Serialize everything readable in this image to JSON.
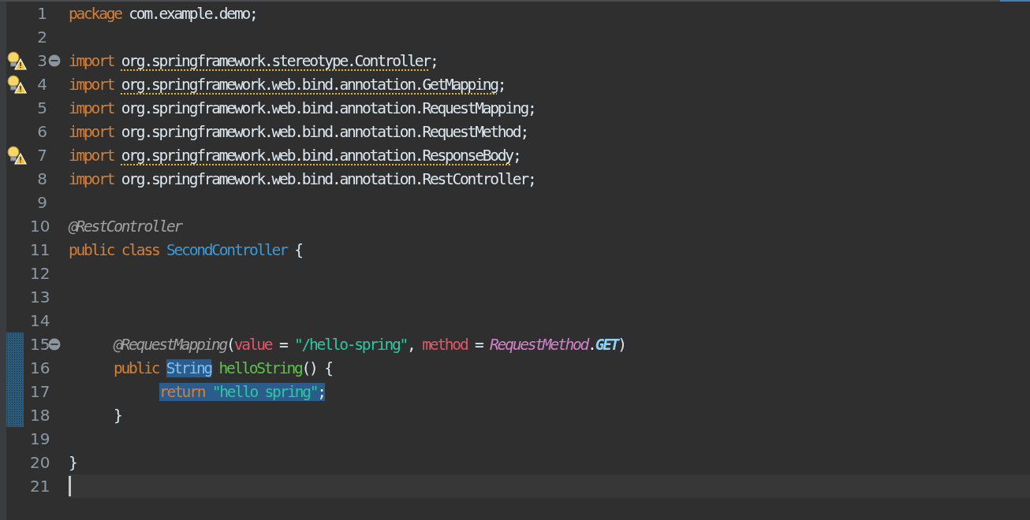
{
  "editor": {
    "lines": [
      {
        "number": "1",
        "kind": "top",
        "warning": false,
        "fold": false,
        "changed": false,
        "current": false,
        "tokens": [
          {
            "text": "package ",
            "kind": "keyword",
            "selected": false
          },
          {
            "text": "com.example.demo;",
            "kind": "plain",
            "selected": false
          }
        ]
      },
      {
        "number": "2",
        "kind": "top",
        "warning": false,
        "fold": false,
        "changed": false,
        "current": false
      },
      {
        "number": "3",
        "kind": "top",
        "warning": true,
        "fold": true,
        "changed": false,
        "current": false,
        "tokens": [
          {
            "text": "import ",
            "kind": "keyword",
            "selected": false
          },
          {
            "text": "org.springframework.stereotype.Controller",
            "kind": "warned",
            "selected": false
          },
          {
            "text": ";",
            "kind": "plain",
            "selected": false
          }
        ]
      },
      {
        "number": "4",
        "kind": "top",
        "warning": true,
        "fold": false,
        "changed": false,
        "current": false,
        "tokens": [
          {
            "text": "import ",
            "kind": "keyword",
            "selected": false
          },
          {
            "text": "org.springframework.web.bind.annotation.GetMapping",
            "kind": "warned",
            "selected": false
          },
          {
            "text": ";",
            "kind": "plain",
            "selected": false
          }
        ]
      },
      {
        "number": "5",
        "kind": "top",
        "warning": false,
        "fold": false,
        "changed": false,
        "current": false,
        "tokens": [
          {
            "text": "import ",
            "kind": "keyword",
            "selected": false
          },
          {
            "text": "org.springframework.web.bind.annotation.RequestMapping;",
            "kind": "plain",
            "selected": false
          }
        ]
      },
      {
        "number": "6",
        "kind": "top",
        "warning": false,
        "fold": false,
        "changed": false,
        "current": false,
        "tokens": [
          {
            "text": "import ",
            "kind": "keyword",
            "selected": false
          },
          {
            "text": "org.springframework.web.bind.annotation.RequestMethod;",
            "kind": "plain",
            "selected": false
          }
        ]
      },
      {
        "number": "7",
        "kind": "top",
        "warning": true,
        "fold": false,
        "changed": false,
        "current": false,
        "tokens": [
          {
            "text": "import ",
            "kind": "keyword",
            "selected": false
          },
          {
            "text": "org.springframework.web.bind.annotation.ResponseBody",
            "kind": "warned",
            "selected": false
          },
          {
            "text": ";",
            "kind": "plain",
            "selected": false
          }
        ]
      },
      {
        "number": "8",
        "kind": "top",
        "warning": false,
        "fold": false,
        "changed": false,
        "current": false,
        "tokens": [
          {
            "text": "import ",
            "kind": "keyword",
            "selected": false
          },
          {
            "text": "org.springframework.web.bind.annotation.RestController;",
            "kind": "plain",
            "selected": false
          }
        ]
      },
      {
        "number": "9",
        "kind": "top",
        "warning": false,
        "fold": false,
        "changed": false,
        "current": false
      },
      {
        "number": "10",
        "kind": "top",
        "warning": false,
        "fold": false,
        "changed": false,
        "current": false,
        "tokens": [
          {
            "text": "@RestController",
            "kind": "annotation",
            "selected": false
          }
        ]
      },
      {
        "number": "11",
        "kind": "top",
        "warning": false,
        "fold": false,
        "changed": false,
        "current": false,
        "tokens": [
          {
            "text": "public class ",
            "kind": "keyword",
            "selected": false
          },
          {
            "text": "SecondController",
            "kind": "type",
            "selected": false
          },
          {
            "text": " {",
            "kind": "plain",
            "selected": false
          }
        ]
      },
      {
        "number": "12",
        "kind": "top",
        "warning": false,
        "fold": false,
        "changed": false,
        "current": false
      },
      {
        "number": "13",
        "kind": "top",
        "warning": false,
        "fold": false,
        "changed": false,
        "current": false
      },
      {
        "number": "14",
        "kind": "top",
        "warning": false,
        "fold": false,
        "changed": false,
        "current": false
      },
      {
        "number": "15",
        "kind": "member",
        "warning": false,
        "fold": true,
        "changed": true,
        "current": false,
        "tokens": [
          {
            "text": "@RequestMapping",
            "kind": "annotation",
            "selected": false
          },
          {
            "text": "(",
            "kind": "plain",
            "selected": false
          },
          {
            "text": "value",
            "kind": "param",
            "selected": false
          },
          {
            "text": " = ",
            "kind": "plain",
            "selected": false
          },
          {
            "text": "\"/hello-spring\"",
            "kind": "string",
            "selected": false
          },
          {
            "text": ", ",
            "kind": "plain",
            "selected": false
          },
          {
            "text": "method",
            "kind": "param",
            "selected": false
          },
          {
            "text": " = ",
            "kind": "plain",
            "selected": false
          },
          {
            "text": "RequestMethod",
            "kind": "enum",
            "selected": false
          },
          {
            "text": ".",
            "kind": "plain",
            "selected": false
          },
          {
            "text": "GET",
            "kind": "constant",
            "selected": false
          },
          {
            "text": ")",
            "kind": "plain",
            "selected": false
          }
        ]
      },
      {
        "number": "16",
        "kind": "member",
        "warning": false,
        "fold": false,
        "changed": true,
        "current": false,
        "tokens": [
          {
            "text": "public ",
            "kind": "keyword",
            "selected": false
          },
          {
            "text": "String",
            "kind": "type",
            "selected": true
          },
          {
            "text": " helloString",
            "kind": "method",
            "selected": false
          },
          {
            "text": "() {",
            "kind": "plain",
            "selected": false
          }
        ]
      },
      {
        "number": "17",
        "kind": "statement",
        "warning": false,
        "fold": false,
        "changed": true,
        "current": false,
        "tokens": [
          {
            "text": "return ",
            "kind": "keyword",
            "selected": true
          },
          {
            "text": "\"hello spring\"",
            "kind": "string",
            "selected": true
          },
          {
            "text": ";",
            "kind": "plain",
            "selected": true
          }
        ]
      },
      {
        "number": "18",
        "kind": "member",
        "warning": false,
        "fold": false,
        "changed": true,
        "current": false,
        "tokens": [
          {
            "text": "}",
            "kind": "plain",
            "selected": false
          }
        ]
      },
      {
        "number": "19",
        "kind": "top",
        "warning": false,
        "fold": false,
        "changed": false,
        "current": false
      },
      {
        "number": "20",
        "kind": "top",
        "warning": false,
        "fold": false,
        "changed": false,
        "current": false,
        "tokens": [
          {
            "text": "}",
            "kind": "plain",
            "selected": false
          }
        ]
      },
      {
        "number": "21",
        "kind": "top",
        "warning": false,
        "fold": false,
        "changed": false,
        "current": true
      }
    ]
  }
}
